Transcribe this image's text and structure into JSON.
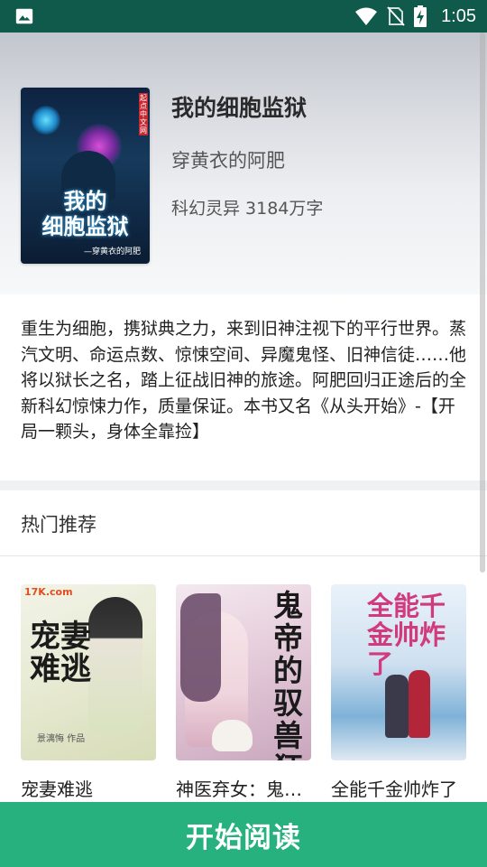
{
  "status_bar": {
    "time": "1:05",
    "icons": [
      "image-icon",
      "wifi-icon",
      "no-sim-icon",
      "battery-charging-icon"
    ]
  },
  "book": {
    "title": "我的细胞监狱",
    "author": "穿黄衣的阿肥",
    "meta": "科幻灵异 3184万字",
    "cover": {
      "title_text": "我的\n细胞监狱",
      "author_text": "—穿黄衣的阿肥",
      "badge_text": "起点中文网"
    },
    "description": " 重生为细胞，携狱典之力，来到旧神注视下的平行世界。蒸汽文明、命运点数、惊悚空间、异魔鬼怪、旧神信徒……他将以狱长之名，踏上征战旧神的旅途。阿肥回归正途后的全新科幻惊悚力作，质量保证。本书又名《从头开始》-【开局一颗头，身体全靠捡】"
  },
  "recommend": {
    "section_title": "热门推荐",
    "items": [
      {
        "name": "宠妻难逃",
        "cover_title": "宠妻难逃",
        "cover_logo": "17K.com",
        "cover_author": "景漓悔 作品"
      },
      {
        "name": "神医弃女：鬼…",
        "cover_title": "鬼帝的驭兽狂妃"
      },
      {
        "name": "全能千金帅炸了",
        "cover_title": "全能千金帅炸了"
      }
    ]
  },
  "actions": {
    "start_reading": "开始阅读"
  },
  "colors": {
    "status_bar": "#0f5a4a",
    "primary_button": "#26b17e"
  }
}
